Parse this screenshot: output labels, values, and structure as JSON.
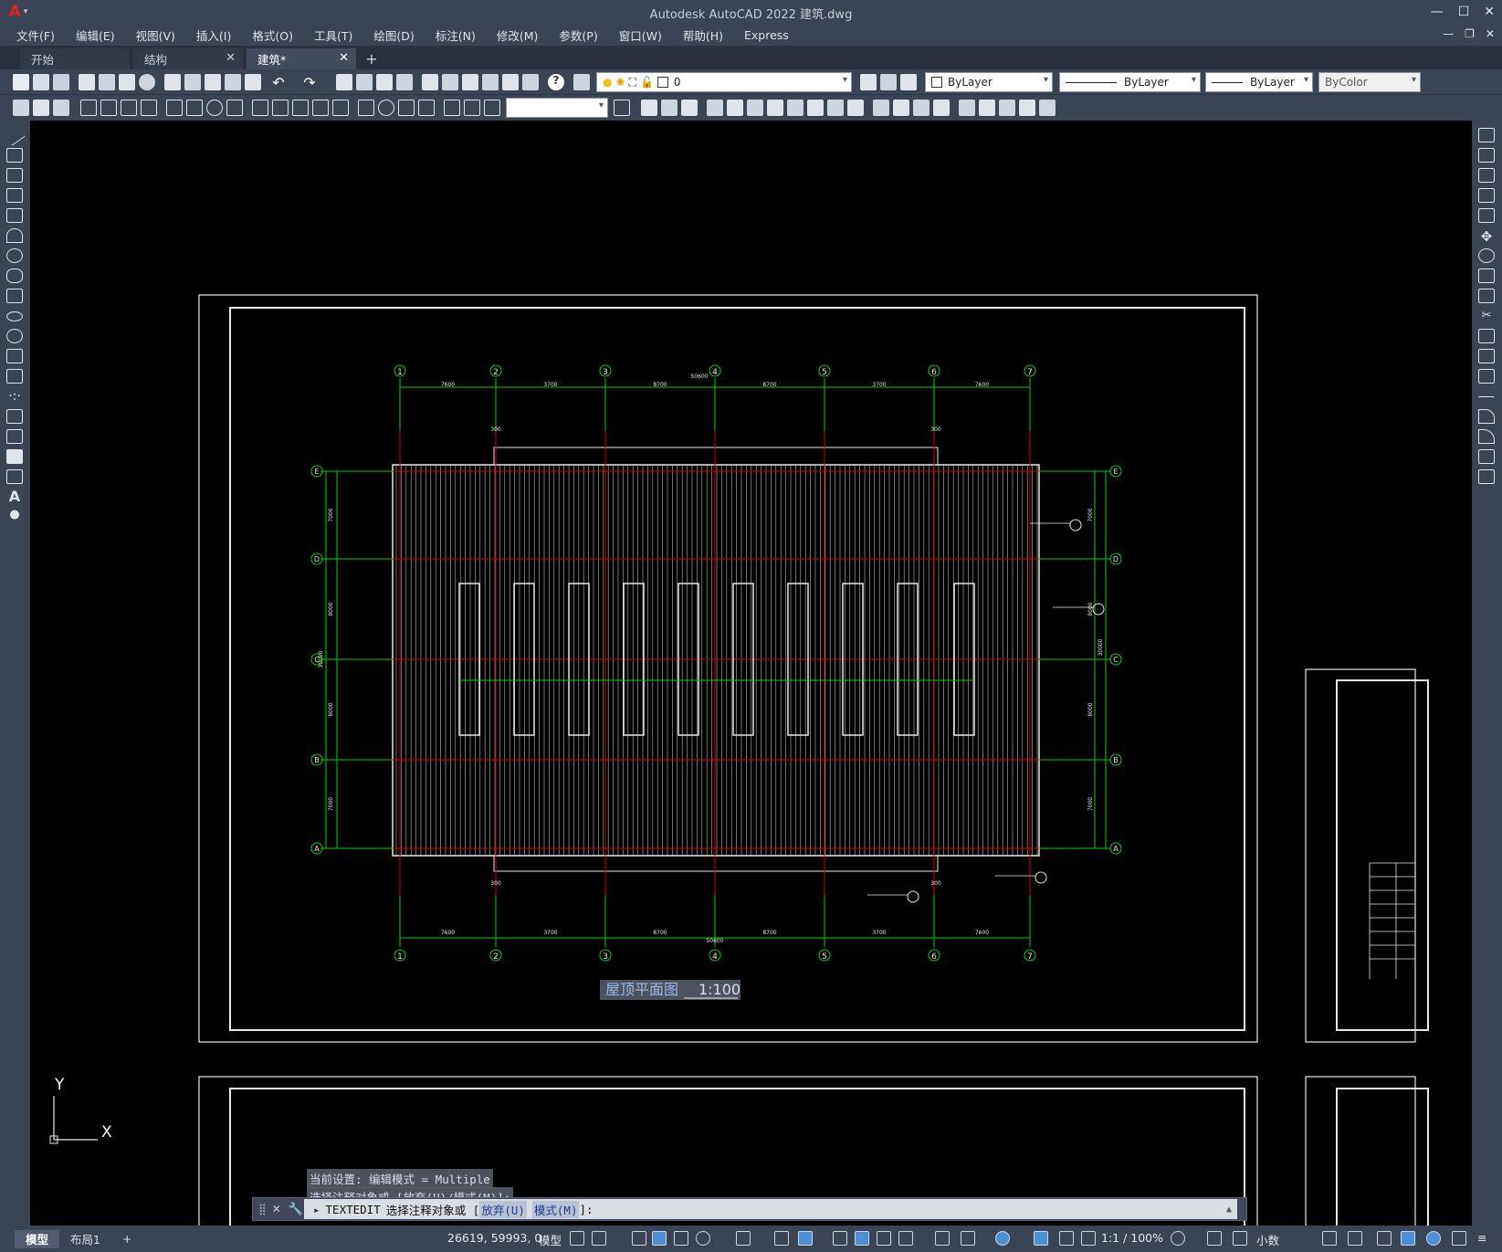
{
  "app": {
    "logo": "A",
    "title": "Autodesk AutoCAD 2022    建筑.dwg",
    "window_controls": [
      "—",
      "☐",
      "✕"
    ],
    "doc_controls": [
      "—",
      "❐",
      "✕"
    ]
  },
  "menu": [
    "文件(F)",
    "编辑(E)",
    "视图(V)",
    "插入(I)",
    "格式(O)",
    "工具(T)",
    "绘图(D)",
    "标注(N)",
    "修改(M)",
    "参数(P)",
    "窗口(W)",
    "帮助(H)",
    "Express"
  ],
  "tabs": [
    {
      "label": "开始",
      "closable": false,
      "active": false
    },
    {
      "label": "结构",
      "closable": true,
      "active": false
    },
    {
      "label": "建筑*",
      "closable": true,
      "active": true
    }
  ],
  "tab_add": "+",
  "properties": {
    "layer": "0",
    "color": "ByLayer",
    "linetype": "ByLayer",
    "lineweight": "ByLayer",
    "plotstyle": "ByColor"
  },
  "drawing": {
    "grid_columns": [
      "1",
      "2",
      "3",
      "4",
      "5",
      "6",
      "7"
    ],
    "grid_rows": [
      "E",
      "D",
      "C",
      "B",
      "A"
    ],
    "top_dims": [
      "7600",
      "3700",
      "8700",
      "8700",
      "3700",
      "7600"
    ],
    "total_dim": "50600",
    "side_dims": [
      "7000",
      "8000",
      "8000",
      "7000"
    ],
    "total_side": "30000",
    "small_dim": "300",
    "title": "屋顶平面图",
    "scale": "1:100"
  },
  "ucs": {
    "x": "X",
    "y": "Y"
  },
  "command": {
    "history": [
      "当前设置: 编辑模式 = Multiple",
      "选择注释对象或 [放弃(U)/模式(M)]:"
    ],
    "prompt_cmd": "TEXTEDIT",
    "prompt_text": "选择注释对象或 [",
    "opt1": "放弃(U)",
    "opt2": "模式(M)",
    "prompt_end": "]:"
  },
  "status": {
    "model_tab": "模型",
    "layout_tab": "布局1",
    "add": "+",
    "coords": "26619, 59993, 0",
    "space": "模型",
    "scale": "1:1 / 100%",
    "units": "小数"
  }
}
